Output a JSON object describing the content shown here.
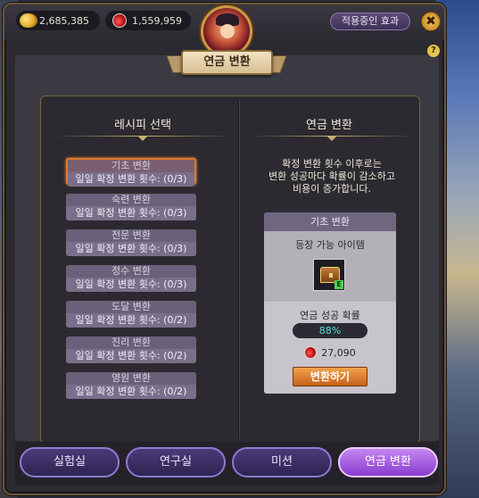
{
  "top_bar": {
    "gold": "2,685,385",
    "gems": "1,559,959",
    "effect_label": "적용중인 효과",
    "close_symbol": "✖",
    "help_symbol": "?"
  },
  "window": {
    "title": "연금 변환"
  },
  "recipe_panel": {
    "title": "레시피 선택",
    "recipes": [
      {
        "name": "기초 변환",
        "count": "일일 확정 변환 횟수: (0/3)"
      },
      {
        "name": "숙련 변환",
        "count": "일일 확정 변환 횟수: (0/3)"
      },
      {
        "name": "전문 변환",
        "count": "일일 확정 변환 횟수: (0/3)"
      },
      {
        "name": "정수 변환",
        "count": "일일 확정 변환 횟수: (0/3)"
      },
      {
        "name": "도달 변환",
        "count": "일일 확정 변환 횟수: (0/2)"
      },
      {
        "name": "진리 변환",
        "count": "일일 확정 변환 횟수: (0/2)"
      },
      {
        "name": "영원 변환",
        "count": "일일 확정 변환 횟수: (0/2)"
      }
    ]
  },
  "convert_panel": {
    "title": "연금 변환",
    "desc1": "확정 변환 횟수 이후로는",
    "desc2": "변환 성공마다 확률이 감소하고",
    "desc3": "비용이 증가합니다.",
    "card_title": "기초 변환",
    "items_label": "등장 가능 아이템",
    "grade_tag": "E",
    "rate_label": "연금 성공 확률",
    "rate": "88%",
    "cost": "27,090",
    "convert_button": "변환하기"
  },
  "tabs": [
    "실험실",
    "연구실",
    "미션",
    "연금 변환"
  ],
  "colors": {
    "accent_active_tab": "#a24ee0",
    "selected_border": "#e07a2a",
    "rate_text": "#5fd9d0"
  }
}
